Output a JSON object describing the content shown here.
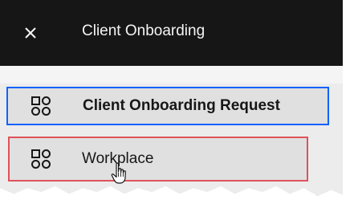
{
  "header": {
    "close_icon": "close-icon",
    "title": "Client Onboarding"
  },
  "menu": {
    "items": [
      {
        "label": "Client Onboarding Request",
        "icon": "app-grid-icon",
        "state": "selected"
      },
      {
        "label": "Workplace",
        "icon": "app-grid-icon",
        "state": "hover"
      }
    ]
  },
  "colors": {
    "header_bg": "#161616",
    "header_text": "#f4f4f4",
    "selected_border": "#0f62fe",
    "hover_border": "#e0525b",
    "item_bg": "#e0e0e0"
  },
  "cursor": "pointer-hand-icon"
}
